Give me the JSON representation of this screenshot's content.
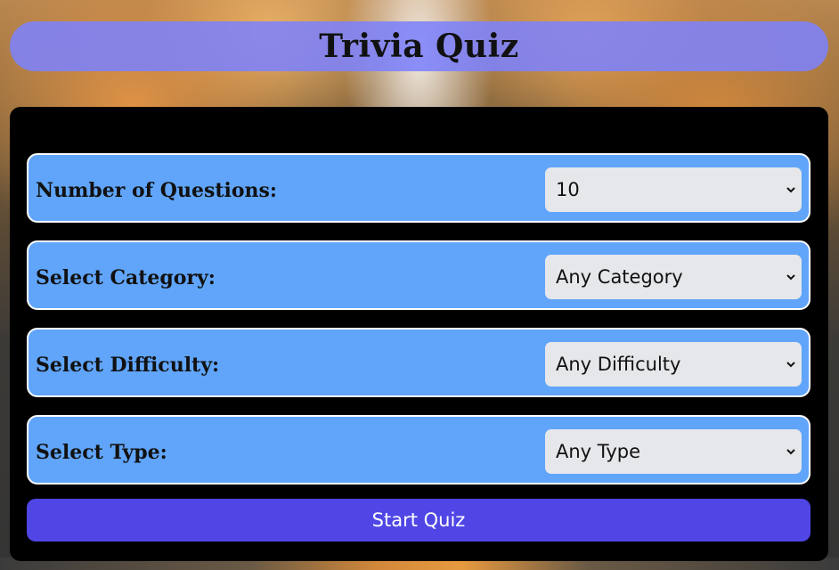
{
  "header": {
    "title": "Trivia Quiz"
  },
  "form": {
    "fields": [
      {
        "label": "Number of Questions:",
        "value": "10"
      },
      {
        "label": "Select Category:",
        "value": "Any Category"
      },
      {
        "label": "Select Difficulty:",
        "value": "Any Difficulty"
      },
      {
        "label": "Select Type:",
        "value": "Any Type"
      }
    ],
    "start_label": "Start Quiz"
  },
  "colors": {
    "header_bg": "#7d82fa",
    "panel_bg": "#000000",
    "row_bg": "#60a5fa",
    "select_bg": "#e6e7eb",
    "button_bg": "#4f46e5"
  },
  "icons": {
    "select_arrow": "chevron-down-icon"
  }
}
